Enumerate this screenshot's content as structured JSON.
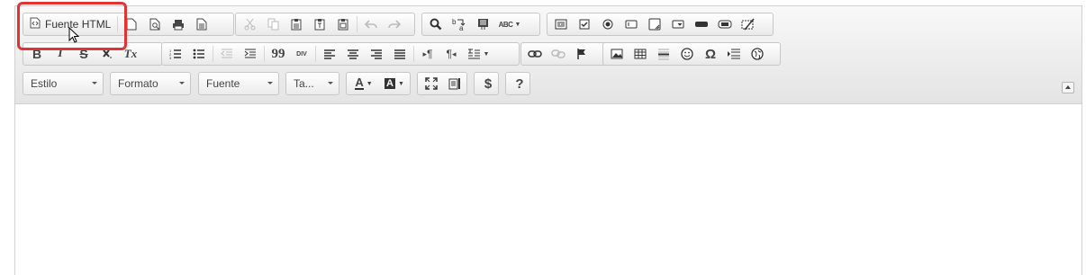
{
  "toolbar": {
    "source_button": {
      "label": "Fuente HTML",
      "icon": "source-icon"
    },
    "document_group": [
      "new-page-icon",
      "preview-icon",
      "print-icon",
      "templates-icon"
    ],
    "clipboard_group": [
      "cut-icon",
      "copy-icon",
      "paste-icon",
      "paste-text-icon",
      "paste-word-icon",
      "undo-icon",
      "redo-icon"
    ],
    "find_group": [
      "find-icon",
      "replace-icon",
      "select-all-icon",
      "spellcheck-icon"
    ],
    "spellcheck_label": "ABC",
    "forms_group": [
      "form-icon",
      "checkbox-icon",
      "radio-icon",
      "text-field-icon",
      "textarea-icon",
      "select-icon",
      "button-icon",
      "image-button-icon",
      "hidden-field-icon"
    ],
    "basic_styles": {
      "bold": "B",
      "italic": "I",
      "strike": "S",
      "remove_format": "Tx"
    },
    "blocks_group": {
      "blockquote": "99",
      "div": "DIV"
    },
    "bidi_group": {
      "ltr": "¶",
      "rtl": "¶"
    },
    "insert_group": [
      "image-icon",
      "table-icon",
      "horizontal-rule-icon",
      "smiley-icon",
      "special-char-icon",
      "page-break-icon",
      "iframe-icon"
    ],
    "special_char_glyph": "Ω",
    "combos": [
      {
        "label": "Estilo"
      },
      {
        "label": "Formato"
      },
      {
        "label": "Fuente"
      },
      {
        "label": "Ta..."
      }
    ],
    "text_color_glyph": "A",
    "bg_color_glyph": "A",
    "dollar_label": "$",
    "help_label": "?"
  },
  "colors": {
    "highlight": "#e03434",
    "toolbar_bg": "#ececec",
    "border": "#c7c7c7"
  }
}
